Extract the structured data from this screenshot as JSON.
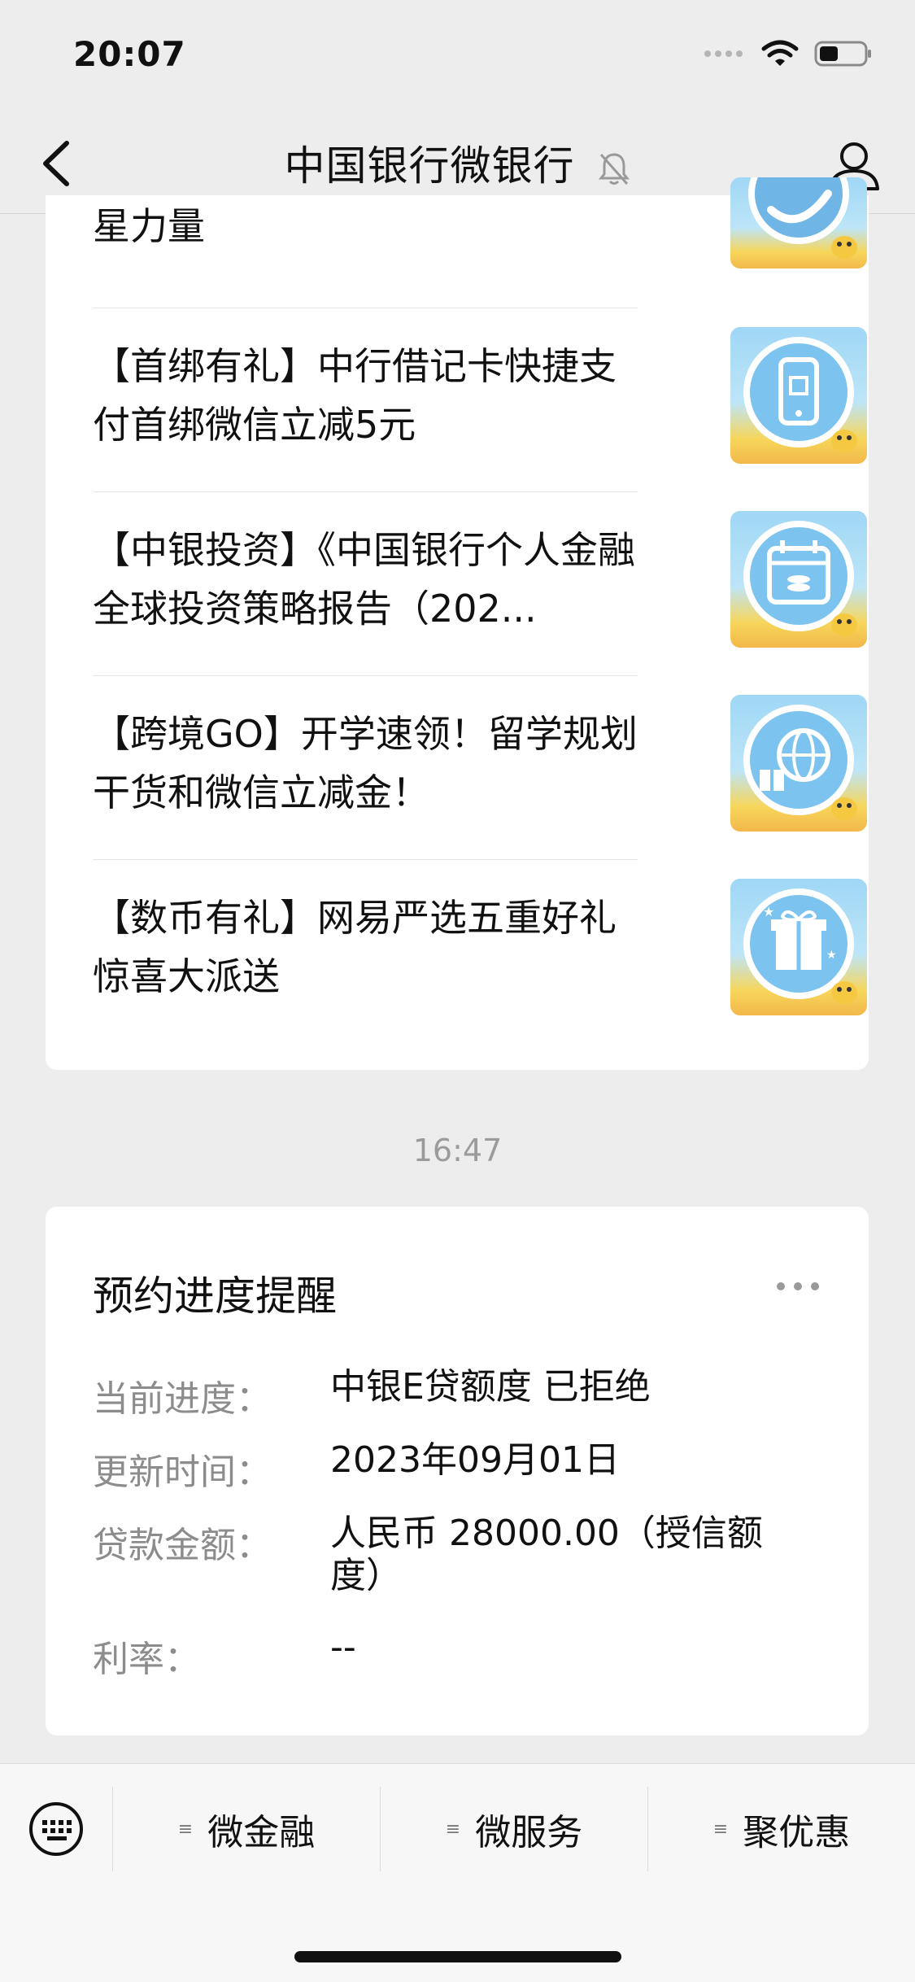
{
  "status_bar": {
    "time": "20:07"
  },
  "nav": {
    "title": "中国银行微银行"
  },
  "articles": [
    {
      "title": "星力量",
      "icon": "rocket-icon"
    },
    {
      "title": "【首绑有礼】中行借记卡快捷支付首绑微信立减5元",
      "icon": "phone-icon"
    },
    {
      "title": "【中银投资】《中国银行个人金融全球投资策略报告（202...",
      "icon": "calendar-coins-icon"
    },
    {
      "title": "【跨境GO】开学速领！留学规划干货和微信立减金！",
      "icon": "globe-gift-icon"
    },
    {
      "title": "【数币有礼】网易严选五重好礼惊喜大派送",
      "icon": "gift-box-icon"
    }
  ],
  "timestamp": "16:47",
  "reminder": {
    "title": "预约进度提醒",
    "fields": [
      {
        "label": "当前进度：",
        "value": "中银E贷额度 已拒绝"
      },
      {
        "label": "更新时间：",
        "value": "2023年09月01日"
      },
      {
        "label": "贷款金额：",
        "value": "人民币 28000.00（授信额度）"
      },
      {
        "label": "利率：",
        "value": "--"
      }
    ]
  },
  "bottom_menu": {
    "items": [
      {
        "label": "微金融"
      },
      {
        "label": "微服务"
      },
      {
        "label": "聚优惠"
      }
    ]
  },
  "colors": {
    "background": "#ededed",
    "card": "#ffffff",
    "muted_text": "#8c8c8c",
    "thumb_blue": "#7cc3ef",
    "thumb_yellow": "#f7d65a"
  }
}
